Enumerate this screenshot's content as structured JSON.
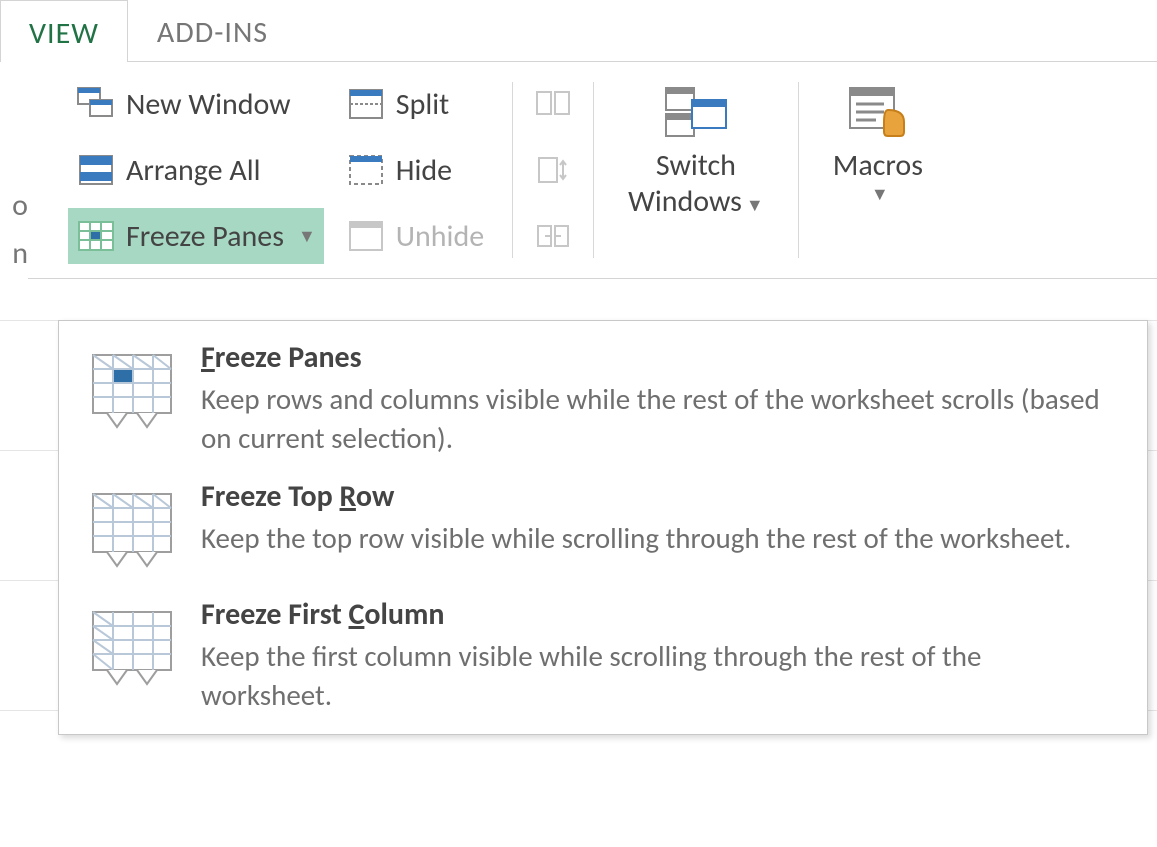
{
  "tabs": {
    "view": "VIEW",
    "addins": "ADD-INS"
  },
  "left_cut": {
    "line1": "o",
    "line2": "n"
  },
  "ribbon": {
    "new_window": "New Window",
    "arrange_all": "Arrange All",
    "freeze_panes": "Freeze Panes",
    "split": "Split",
    "hide": "Hide",
    "unhide": "Unhide",
    "switch_windows_line1": "Switch",
    "switch_windows_line2": "Windows",
    "macros": "Macros"
  },
  "menu": {
    "items": [
      {
        "title_pre": "",
        "title_ul": "F",
        "title_post": "reeze Panes",
        "desc": "Keep rows and columns visible while the rest of the worksheet scrolls (based on current selection)."
      },
      {
        "title_pre": "Freeze Top ",
        "title_ul": "R",
        "title_post": "ow",
        "desc": "Keep the top row visible while scrolling through the rest of the worksheet."
      },
      {
        "title_pre": "Freeze First ",
        "title_ul": "C",
        "title_post": "olumn",
        "desc": "Keep the first column visible while scrolling through the rest of the worksheet."
      }
    ]
  }
}
